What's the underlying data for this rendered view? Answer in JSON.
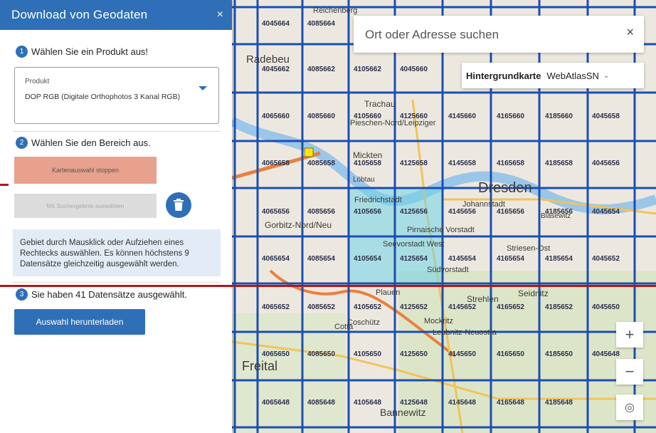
{
  "panel": {
    "title": "Download von Geodaten",
    "close_icon": "×",
    "step1": {
      "num": "1",
      "text": "Wählen Sie ein Produkt aus!"
    },
    "product": {
      "label": "Produkt",
      "value": "DOP RGB (Digitale Orthophotos 3 Kanal RGB)"
    },
    "step2": {
      "num": "2",
      "text": "Wählen Sie den Bereich aus."
    },
    "btn_stop": "Kartenauswahl stoppen",
    "btn_edit": "Mit Suchergebnis auswählen",
    "info": "Gebiet durch Mausklick oder Aufziehen eines Rechtecks auswählen. Es können höchstens 9 Datensätze gleichzeitig ausgewählt werden.",
    "step3": {
      "num": "3",
      "text": "Sie haben 41 Datensätze ausgewählt."
    },
    "btn_download": "Auswahl herunterladen"
  },
  "search": {
    "placeholder": "Ort oder Adresse suchen",
    "clear_icon": "×"
  },
  "basemap": {
    "label": "Hintergrundkarte",
    "value": "WebAtlasSN",
    "caret": "⌄"
  },
  "zoom": {
    "in": "+",
    "out": "−",
    "locate": "◎"
  },
  "map": {
    "places": [
      "Radebeu",
      "Reichenberg",
      "Trachau",
      "Pieschen-Nord/Leipziger",
      "Mickten",
      "Friedrichstadt",
      "Dresden",
      "Johannstadt",
      "Löbtau",
      "Gorbitz-Nord/Neu",
      "Seevorstadt West",
      "Strehlen",
      "Plauen",
      "Freital",
      "Cotta",
      "Pirnaische Vorstadt",
      "Leubnitz-Neuostra",
      "Südvorstadt",
      "Bannewitz",
      "Coschütz",
      "Mockritz",
      "Seidnitz",
      "Striesen-Ost",
      "Blasewitz"
    ],
    "row_codes": [
      "4045664",
      "4085664",
      "4045662",
      "4085662",
      "4105662",
      "4045660",
      "4065660",
      "4085660",
      "4105660",
      "4125660",
      "4145660",
      "4165660",
      "4185660",
      "4045658",
      "4065658",
      "4085658",
      "4105658",
      "4125658",
      "4145658",
      "4165658",
      "4185658",
      "4045656",
      "4065656",
      "4085656",
      "4105656",
      "4125656",
      "4145656",
      "4165656",
      "4185656",
      "4045654",
      "4065654",
      "4085654",
      "4105654",
      "4125654",
      "4145654",
      "4165654",
      "4185654",
      "4045652",
      "4065652",
      "4085652",
      "4105652",
      "4125652",
      "4145652",
      "4165652",
      "4185652",
      "4045650",
      "4065650",
      "4085650",
      "4105650",
      "4125650",
      "4145650",
      "4165650",
      "4185650",
      "4045648",
      "4065648",
      "4085648",
      "4105648",
      "4125648",
      "4145648",
      "4165648",
      "4185648"
    ]
  },
  "colors": {
    "primary": "#2f6fb7",
    "stop": "#e8a18c",
    "grid": "#1a4fb0",
    "selected": "#6fd3e6",
    "annotation": "#b01818"
  }
}
